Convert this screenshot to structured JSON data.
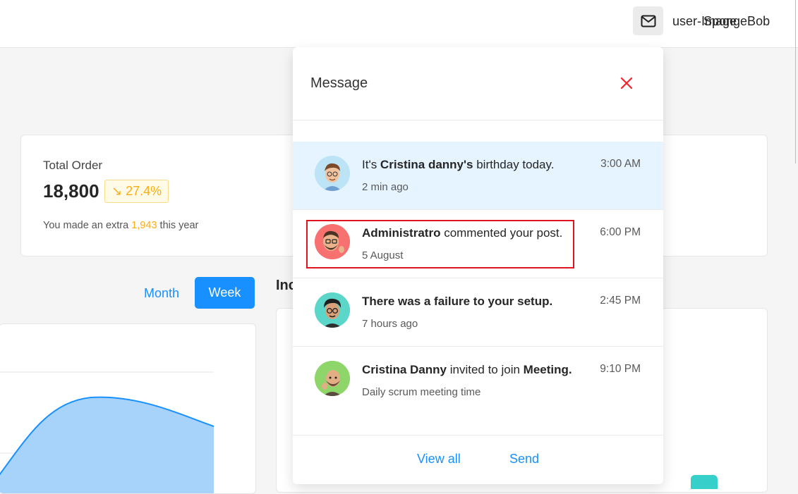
{
  "header": {
    "mail_icon": "mail-icon",
    "username_a": "user-",
    "username_b": "Image",
    "username_c": "SpongeBob"
  },
  "summary": {
    "label": "Total Order",
    "value": "18,800",
    "badge": "↘ 27.4%",
    "sub_prefix": "You made an extra ",
    "sub_highlight": "1,943",
    "sub_suffix": " this year"
  },
  "tabs": {
    "month": "Month",
    "week": "Week"
  },
  "income_title": "Inc",
  "popup": {
    "title": "Message",
    "close_icon": "close-icon",
    "view_all": "View all",
    "send": "Send"
  },
  "messages": [
    {
      "pre": "It's ",
      "bold": "Cristina danny's",
      "post": " birthday today.",
      "bold2": "",
      "sub": "2 min ago",
      "time": "3:00 AM"
    },
    {
      "pre": "",
      "bold": "Administratro",
      "post": " commented your post.",
      "bold2": "",
      "sub": "5 August",
      "time": "6:00 PM"
    },
    {
      "pre": "",
      "bold": "There was a failure to your setup.",
      "post": "",
      "bold2": "",
      "sub": "7 hours ago",
      "time": "2:45 PM"
    },
    {
      "pre": "",
      "bold": "Cristina Danny",
      "post": " invited to join ",
      "bold2": "Meeting.",
      "sub": "Daily scrum meeting time",
      "time": "9:10 PM"
    }
  ],
  "colors": {
    "primary": "#1890ff",
    "warning": "#faad14",
    "close": "#f5222d",
    "highlight_box": "#e0141e"
  }
}
